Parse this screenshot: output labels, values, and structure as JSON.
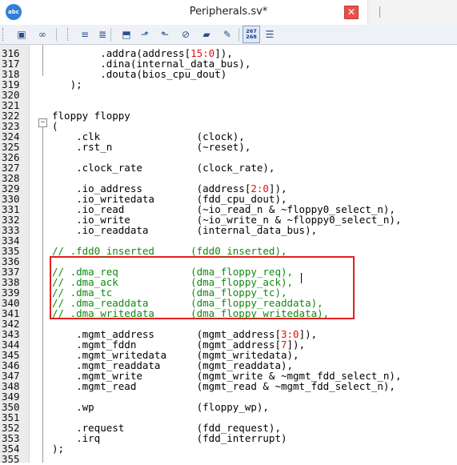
{
  "window": {
    "title": "Peripherals.sv*",
    "app_icon_label": "abc",
    "close_label": "✕"
  },
  "toolbar": {
    "buttons": [
      {
        "name": "view-icon",
        "glyph": "▣"
      },
      {
        "name": "binoculars-icon",
        "glyph": "∞"
      },
      {
        "name": "indent-icon",
        "glyph": "≡"
      },
      {
        "name": "outdent-icon",
        "glyph": "≣"
      },
      {
        "name": "bookmark-add-icon",
        "glyph": "⬒"
      },
      {
        "name": "bookmark-next-icon",
        "glyph": "⬏"
      },
      {
        "name": "bookmark-prev-icon",
        "glyph": "⬑"
      },
      {
        "name": "paperclip-icon",
        "glyph": "⊘"
      },
      {
        "name": "book-icon",
        "glyph": "▰"
      },
      {
        "name": "edit-icon",
        "glyph": "✎"
      },
      {
        "name": "line-numbers-icon",
        "glyph": ""
      },
      {
        "name": "list-icon",
        "glyph": "☰"
      }
    ],
    "line_numbers_button": {
      "top": "267",
      "bottom": "268"
    }
  },
  "editor": {
    "lines": [
      {
        "n": "316",
        "code": "        .addra(address[",
        "num": "15:0",
        "tail": "]),",
        "comment": false
      },
      {
        "n": "317",
        "code": "        .dina(internal_data_bus),",
        "comment": false
      },
      {
        "n": "318",
        "code": "        .douta(bios_cpu_dout)",
        "comment": false
      },
      {
        "n": "319",
        "code": "   );",
        "comment": false
      },
      {
        "n": "320",
        "code": "",
        "comment": false
      },
      {
        "n": "321",
        "code": "",
        "comment": false
      },
      {
        "n": "322",
        "code": "floppy floppy",
        "comment": false
      },
      {
        "n": "323",
        "code": "(",
        "comment": false
      },
      {
        "n": "324",
        "code": "    .clk                (clock),",
        "comment": false
      },
      {
        "n": "325",
        "code": "    .rst_n              (~reset),",
        "comment": false
      },
      {
        "n": "326",
        "code": "",
        "comment": false
      },
      {
        "n": "327",
        "code": "    .clock_rate         (clock_rate),",
        "comment": false
      },
      {
        "n": "328",
        "code": "",
        "comment": false
      },
      {
        "n": "329",
        "code": "    .io_address         (address[",
        "num": "2:0",
        "tail": "]),",
        "comment": false
      },
      {
        "n": "330",
        "code": "    .io_writedata       (fdd_cpu_dout),",
        "comment": false
      },
      {
        "n": "331",
        "code": "    .io_read            (~io_read_n & ~floppy0_select_n),",
        "comment": false
      },
      {
        "n": "332",
        "code": "    .io_write           (~io_write_n & ~floppy0_select_n),",
        "comment": false
      },
      {
        "n": "333",
        "code": "    .io_readdata        (internal_data_bus),",
        "comment": false
      },
      {
        "n": "334",
        "code": "",
        "comment": false
      },
      {
        "n": "335",
        "code": "// .fdd0_inserted      (fdd0_inserted),",
        "comment": true
      },
      {
        "n": "336",
        "code": "",
        "comment": false
      },
      {
        "n": "337",
        "code": "// .dma_req            (dma_floppy_req),",
        "comment": true
      },
      {
        "n": "338",
        "code": "// .dma_ack            (dma_floppy_ack),",
        "comment": true
      },
      {
        "n": "339",
        "code": "// .dma_tc             (dma_floppy_tc),",
        "comment": true
      },
      {
        "n": "340",
        "code": "// .dma_readdata       (dma_floppy_readdata),",
        "comment": true
      },
      {
        "n": "341",
        "code": "// .dma_writedata      (dma_floppy_writedata),",
        "comment": true
      },
      {
        "n": "342",
        "code": "",
        "comment": false
      },
      {
        "n": "343",
        "code": "    .mgmt_address       (mgmt_address[",
        "num": "3:0",
        "tail": "]),",
        "comment": false
      },
      {
        "n": "344",
        "code": "    .mgmt_fddn          (mgmt_address[",
        "num": "7",
        "tail": "]),",
        "comment": false
      },
      {
        "n": "345",
        "code": "    .mgmt_writedata     (mgmt_writedata),",
        "comment": false
      },
      {
        "n": "346",
        "code": "    .mgmt_readdata      (mgmt_readdata),",
        "comment": false
      },
      {
        "n": "347",
        "code": "    .mgmt_write         (mgmt_write & ~mgmt_fdd_select_n),",
        "comment": false
      },
      {
        "n": "348",
        "code": "    .mgmt_read          (mgmt_read & ~mgmt_fdd_select_n),",
        "comment": false
      },
      {
        "n": "349",
        "code": "",
        "comment": false
      },
      {
        "n": "350",
        "code": "    .wp                 (floppy_wp),",
        "comment": false
      },
      {
        "n": "351",
        "code": "",
        "comment": false
      },
      {
        "n": "352",
        "code": "    .request            (fdd_request),",
        "comment": false
      },
      {
        "n": "353",
        "code": "    .irq                (fdd_interrupt)",
        "comment": false
      },
      {
        "n": "354",
        "code": ");",
        "comment": false
      },
      {
        "n": "355",
        "code": "",
        "comment": false
      }
    ]
  }
}
